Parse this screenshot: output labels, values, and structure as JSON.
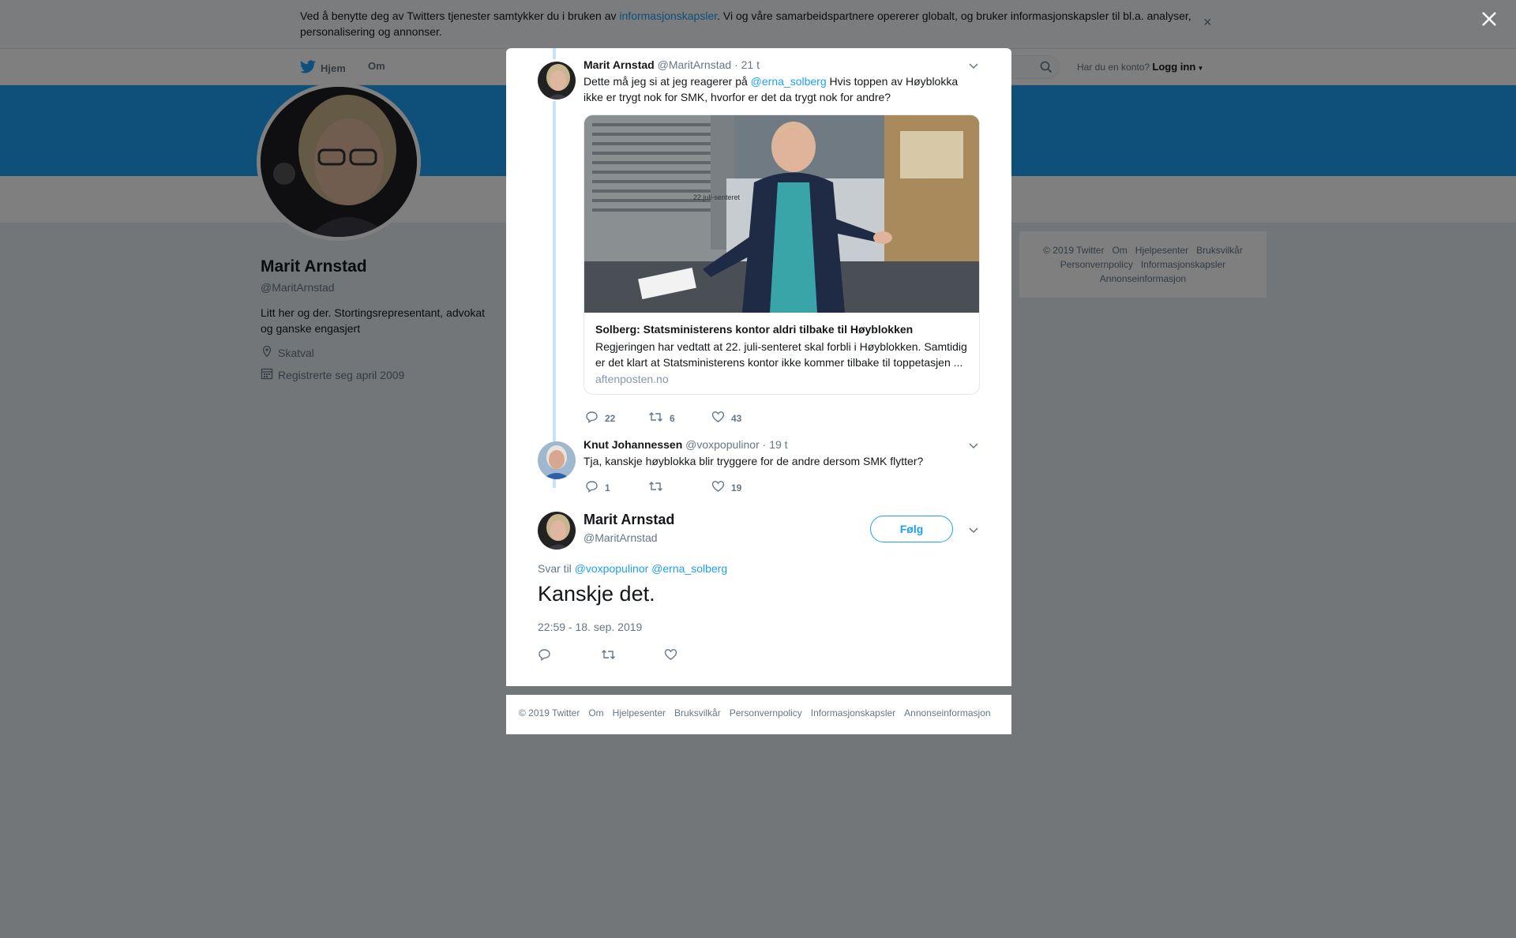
{
  "cookie_banner": {
    "text_before": "Ved å benytte deg av Twitters tjenester samtykker du i bruken av ",
    "link": "informasjonskapsler",
    "text_after": ". Vi og våre samarbeidspartnere opererer globalt, og bruker informasjonskapsler til bl.a. analyser, personalisering og annonser.",
    "close": "×"
  },
  "nav": {
    "home": "Hjem",
    "about": "Om",
    "login_prompt": "Har du en konto?",
    "login": "Logg inn"
  },
  "profile": {
    "name": "Marit Arnstad",
    "handle": "@MaritArnstad",
    "bio": "Litt her og der. Stortingsrepresentant, advokat og ganske engasjert",
    "location": "Skatval",
    "joined": "Registrerte seg april 2009"
  },
  "side_footer": [
    "© 2019 Twitter",
    "Om",
    "Hjelpesenter",
    "Bruksvilkår",
    "Personvernpolicy",
    "Informasjonskapsler",
    "Annonseinformasjon"
  ],
  "thread": {
    "tweet1": {
      "name": "Marit Arnstad",
      "handle": "@MaritArnstad",
      "time": "· 21 t",
      "text_before": "Dette må jeg si at jeg reagerer på ",
      "mention": "@erna_solberg",
      "text_after": " Hvis toppen av Høyblokka ikke er trygt nok for SMK, hvorfor er det da trygt nok for andre?",
      "card": {
        "sign_text": "22.juli-senteret",
        "title": "Solberg: Statsministerens kontor aldri tilbake til Høyblokken",
        "description": "Regjeringen har vedtatt at 22. juli-senteret skal forbli i Høyblokken. Samtidig er det klart at Statsministerens kontor ikke kommer tilbake til toppetasjen ...",
        "domain": "aftenposten.no"
      },
      "replies": "22",
      "retweets": "6",
      "likes": "43"
    },
    "tweet2": {
      "name": "Knut Johannessen",
      "handle": "@voxpopulinor",
      "time": "· 19 t",
      "text": "Tja, kanskje høyblokka blir tryggere for de andre dersom SMK flytter?",
      "replies": "1",
      "retweets": "",
      "likes": "19"
    },
    "main": {
      "name": "Marit Arnstad",
      "handle": "@MaritArnstad",
      "follow": "Følg",
      "reply_prefix": "Svar til ",
      "reply_mention1": "@voxpopulinor",
      "reply_mention2": "@erna_solberg",
      "text": "Kanskje det.",
      "timestamp": "22:59 - 18. sep. 2019"
    }
  },
  "modal_footer": [
    "© 2019 Twitter",
    "Om",
    "Hjelpesenter",
    "Bruksvilkår",
    "Personvernpolicy",
    "Informasjonskapsler",
    "Annonseinformasjon"
  ],
  "colors": {
    "accent": "#1da1f2",
    "banner": "#1da1f2",
    "thread_line": "#c6e4f7",
    "muted": "#657786"
  },
  "icons": [
    "twitter-bird-icon",
    "search-icon",
    "location-icon",
    "calendar-icon",
    "chevron-down-icon",
    "reply-icon",
    "retweet-icon",
    "heart-icon",
    "close-icon"
  ]
}
